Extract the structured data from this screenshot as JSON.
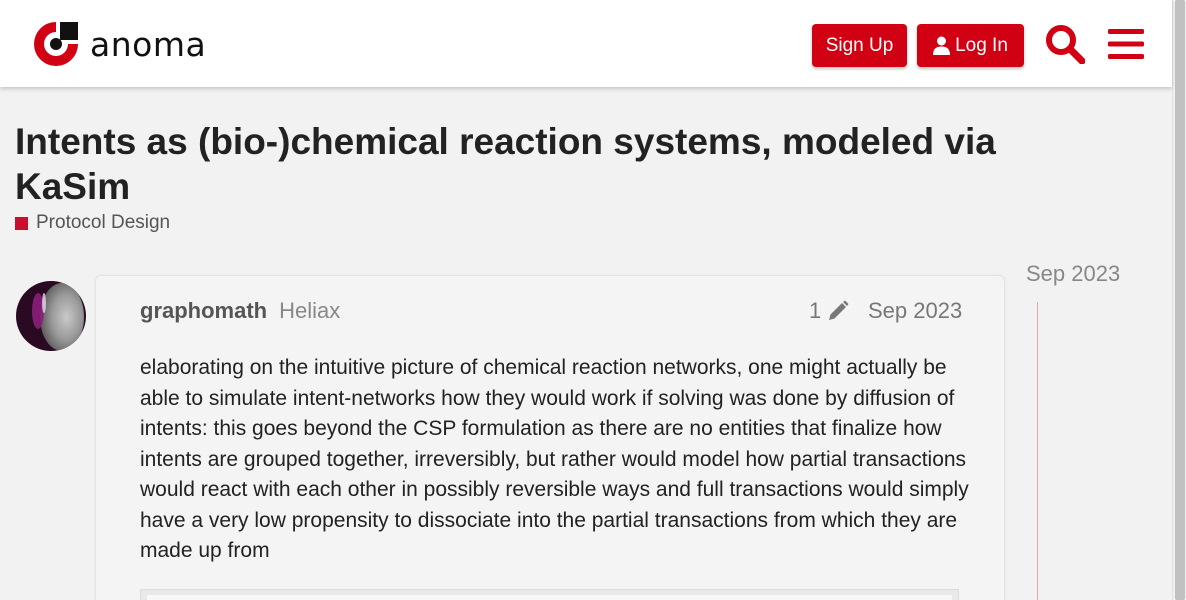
{
  "header": {
    "brand_name": "anoma",
    "signup_label": "Sign Up",
    "login_label": "Log In",
    "accent_color": "#d10012",
    "icons": [
      "anoma-logo-icon",
      "user-icon",
      "search-icon",
      "hamburger-menu-icon"
    ]
  },
  "topic": {
    "title": "Intents as (bio-)chemical reaction systems, modeled via KaSim",
    "category": {
      "name": "Protocol Design",
      "color": "#c8102e"
    }
  },
  "post": {
    "username": "graphomath",
    "user_title": "Heliax",
    "edit_count": "1",
    "date": "Sep 2023",
    "body": "elaborating on the intuitive picture of chemical reaction networks, one might actually be able to simulate intent-networks how they would work if solving was done by diffusion of intents: this goes beyond the CSP formulation as there are no entities that finalize how intents are grouped together, irreversibly, but rather would model how partial transactions would react with each other in possibly reversible ways and full transactions would simply have a very low propensity to dissociate into the partial transactions from which they are made up from"
  },
  "timeline": {
    "date_label": "Sep 2023"
  }
}
